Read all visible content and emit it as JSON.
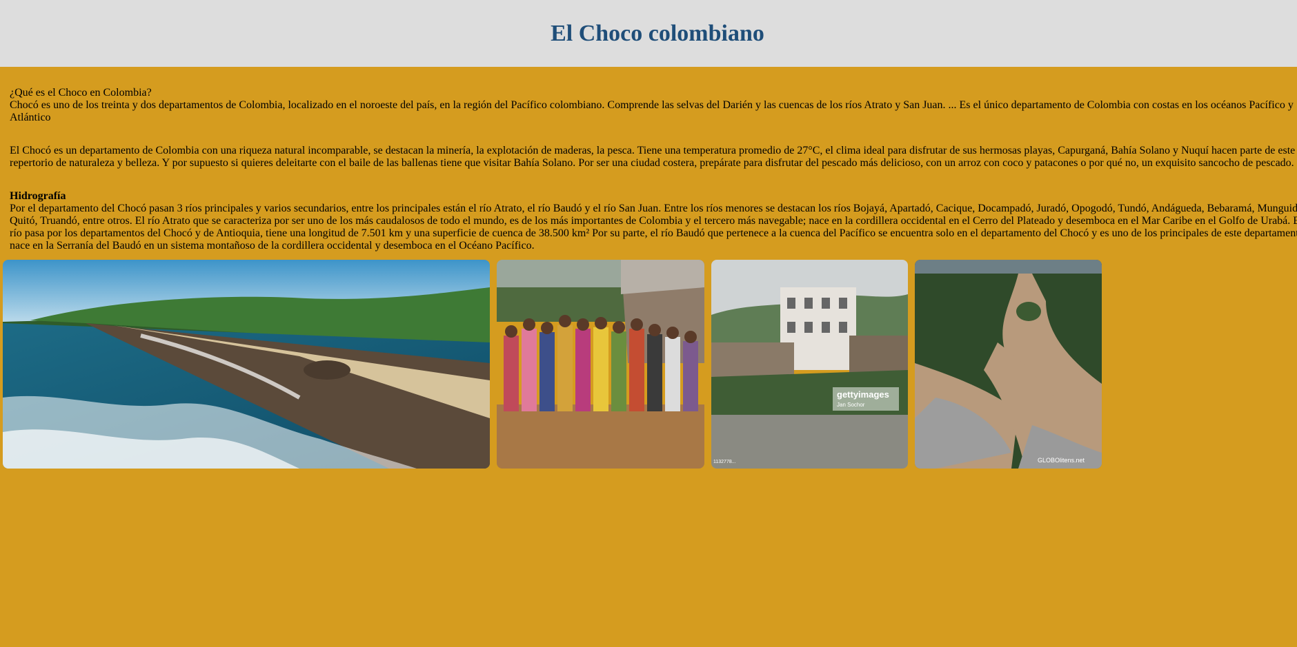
{
  "page": {
    "title": "El Choco colombiano"
  },
  "intro": {
    "question": "¿Qué es el Choco en Colombia?",
    "answer": "Chocó es uno de los treinta y dos departamentos de Colombia, localizado en el noroeste del país, en la región del Pacífico colombiano. Comprende las selvas del Darién y las cuencas de los ríos Atrato y San Juan. ... Es el único departamento de Colombia con costas en los océanos Pacífico y Atlántico"
  },
  "tourism": {
    "text": "El Chocó es un departamento de Colombia con una riqueza natural incomparable, se destacan la minería, la explotación de maderas, la pesca. Tiene una temperatura promedio de 27°C, el clima ideal para disfrutar de sus hermosas playas, Capurganá, Bahía Solano y Nuquí hacen parte de este repertorio de naturaleza y belleza. Y por supuesto si quieres deleitarte con el baile de las ballenas tiene que visitar Bahía Solano. Por ser una ciudad costera, prepárate para disfrutar del pescado más delicioso, con un arroz con coco y patacones o por qué no, un exquisito sancocho de pescado."
  },
  "hydrography": {
    "heading": "Hidrografía",
    "text": "Por el departamento del Chocó pasan 3 ríos principales y varios secundarios, entre los principales están el río Atrato, el río Baudó y el río San Juan. Entre los ríos menores se destacan los ríos Bojayá, Apartadó, Cacique, Docampadó, Juradó, Opogodó, Tundó, Andágueda, Bebaramá, Munguidó, Quitó, Truandó, entre otros. El río Atrato que se caracteriza por ser uno de los más caudalosos de todo el mundo, es de los más importantes de Colombia y el tercero más navegable; nace en la cordillera occidental en el Cerro del Plateado y desemboca en el Mar Caribe en el Golfo de Urabá. El río pasa por los departamentos del Chocó y de Antioquia, tiene una longitud de 7.501 km y una superficie de cuenca de 38.500 km² Por su parte, el río Baudó que pertenece a la cuenca del Pacífico se encuentra solo en el departamento del Chocó y es uno de los principales de este departamento, nace en la Serranía del Baudó en un sistema montañoso de la cordillera occidental y desemboca en el Océano Pacífico."
  },
  "gallery": {
    "watermark_getty": "gettyimages",
    "watermark_getty_credit": "Jan Sochor",
    "watermark_getty_id": "1132778...",
    "watermark_flood": "GLOBOlitens.net"
  },
  "colors": {
    "page_background": "#d59c1f",
    "header_background": "#dddddd",
    "title_color": "#1f4e79"
  }
}
